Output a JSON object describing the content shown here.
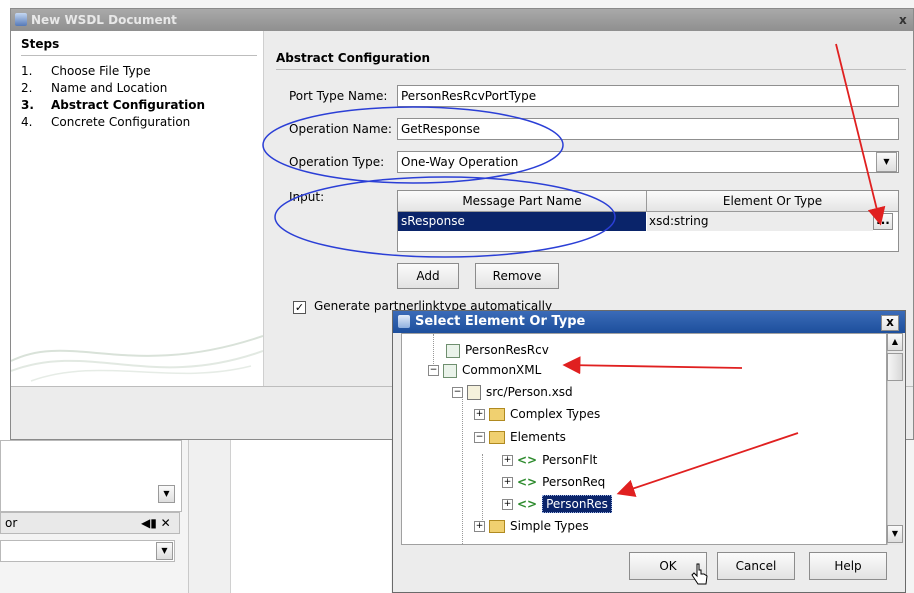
{
  "main_dialog": {
    "title": "New WSDL Document",
    "close_glyph": "x",
    "steps": {
      "heading": "Steps",
      "items": [
        {
          "num": "1.",
          "label": "Choose File Type"
        },
        {
          "num": "2.",
          "label": "Name and Location"
        },
        {
          "num": "3.",
          "label": "Abstract Configuration"
        },
        {
          "num": "4.",
          "label": "Concrete Configuration"
        }
      ]
    },
    "section_title": "Abstract Configuration",
    "port_type_name": {
      "label": "Port Type Name:",
      "value": "PersonResRcvPortType"
    },
    "operation_name": {
      "label": "Operation Name:",
      "value": "GetResponse"
    },
    "operation_type": {
      "label": "Operation Type:",
      "value": "One-Way Operation"
    },
    "input": {
      "label": "Input:",
      "columns": [
        "Message Part Name",
        "Element Or Type"
      ],
      "rows": [
        {
          "part": "sResponse",
          "type": "xsd:string"
        }
      ],
      "browse_label": "..."
    },
    "add_button": "Add",
    "remove_button": "Remove",
    "generate_checkbox": "Generate partnerlinktype automatically"
  },
  "sub_dialog": {
    "title": "Select Element Or Type",
    "close_glyph": "x",
    "tree": [
      {
        "label": "PersonResRcv",
        "icon": "project-icon"
      },
      {
        "label": "CommonXML",
        "icon": "project-icon"
      },
      {
        "label": "src/Person.xsd",
        "icon": "xsd-file-icon"
      },
      {
        "label": "Complex Types",
        "icon": "folder-icon"
      },
      {
        "label": "Elements",
        "icon": "folder-open-icon"
      },
      {
        "label": "PersonFlt",
        "icon": "element-icon"
      },
      {
        "label": "PersonReq",
        "icon": "element-icon"
      },
      {
        "label": "PersonRes",
        "icon": "element-icon"
      },
      {
        "label": "Simple Types",
        "icon": "folder-icon"
      }
    ],
    "ok_button": "OK",
    "cancel_button": "Cancel",
    "help_button": "Help"
  },
  "background": {
    "panel_label": "or"
  },
  "colors": {
    "annotation_red": "#e02020",
    "annotation_blue": "#2b3fd6",
    "selection": "#0a246a"
  }
}
